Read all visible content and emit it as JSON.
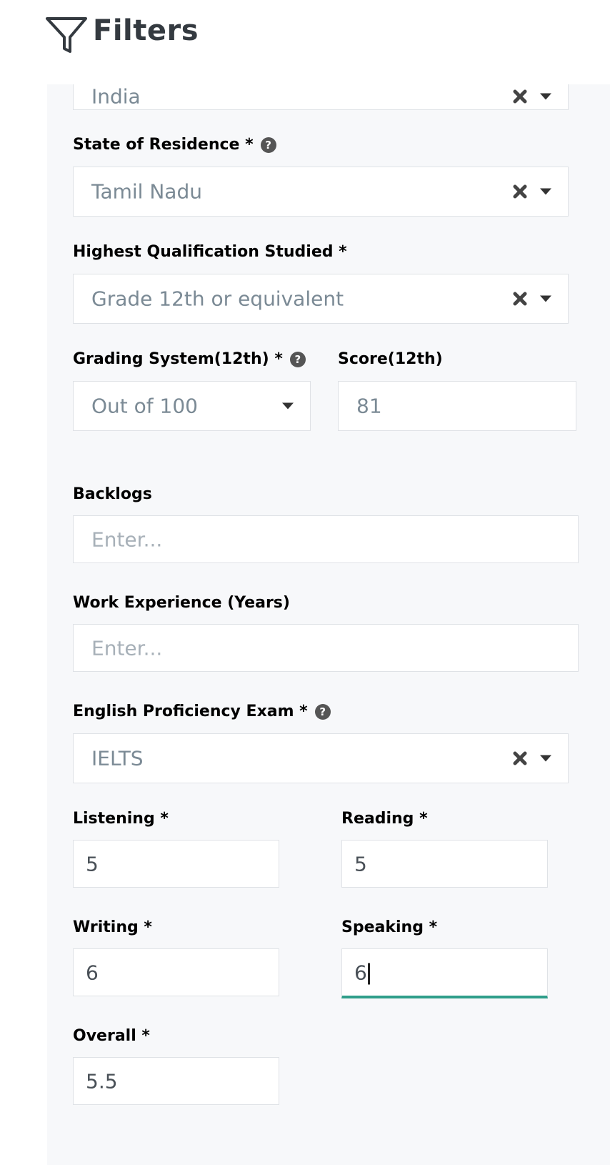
{
  "header": {
    "title": "Filters",
    "icon": "filter-icon"
  },
  "country": {
    "value": "India"
  },
  "state": {
    "label": "State of Residence *",
    "value": "Tamil Nadu"
  },
  "qualification": {
    "label": "Highest Qualification Studied *",
    "value": "Grade 12th or equivalent"
  },
  "grading": {
    "label": "Grading System(12th) *",
    "value": "Out of 100"
  },
  "score": {
    "label": "Score(12th)",
    "value": "81"
  },
  "backlogs": {
    "label": "Backlogs",
    "placeholder": "Enter..."
  },
  "work_experience": {
    "label": "Work Experience (Years)",
    "placeholder": "Enter..."
  },
  "english_exam": {
    "label": "English Proficiency Exam *",
    "value": "IELTS"
  },
  "listening": {
    "label": "Listening *",
    "value": "5"
  },
  "reading": {
    "label": "Reading *",
    "value": "5"
  },
  "writing": {
    "label": "Writing *",
    "value": "6"
  },
  "speaking": {
    "label": "Speaking *",
    "value": "6"
  },
  "overall": {
    "label": "Overall *",
    "value": "5.5"
  },
  "help_glyph": "?",
  "colors": {
    "accent": "#2f9e8a",
    "panel_bg": "#f7f8fa",
    "title": "#343a40",
    "value_text": "#7b8a95"
  }
}
